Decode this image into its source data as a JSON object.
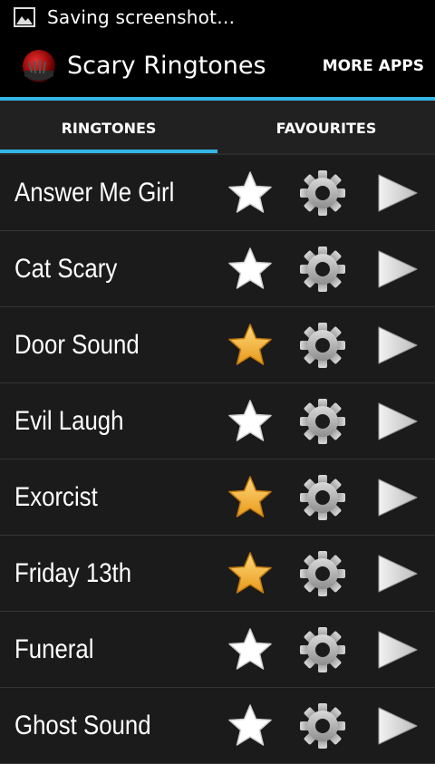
{
  "status_bar": {
    "notification_text": "Saving screenshot…"
  },
  "action_bar": {
    "title": "Scary Ringtones",
    "more_apps_label": "MORE APPS"
  },
  "tabs": [
    {
      "label": "RINGTONES",
      "selected": true
    },
    {
      "label": "FAVOURITES",
      "selected": false
    }
  ],
  "colors": {
    "accent": "#33b5e5",
    "favorite_star": "#f6b63a",
    "plain_star": "#ffffff"
  },
  "ringtones": [
    {
      "name": "Answer Me Girl",
      "favorite": false
    },
    {
      "name": "Cat Scary",
      "favorite": false
    },
    {
      "name": "Door Sound",
      "favorite": true
    },
    {
      "name": "Evil Laugh",
      "favorite": false
    },
    {
      "name": "Exorcist",
      "favorite": true
    },
    {
      "name": "Friday 13th",
      "favorite": true
    },
    {
      "name": "Funeral",
      "favorite": false
    },
    {
      "name": "Ghost Sound",
      "favorite": false
    }
  ]
}
